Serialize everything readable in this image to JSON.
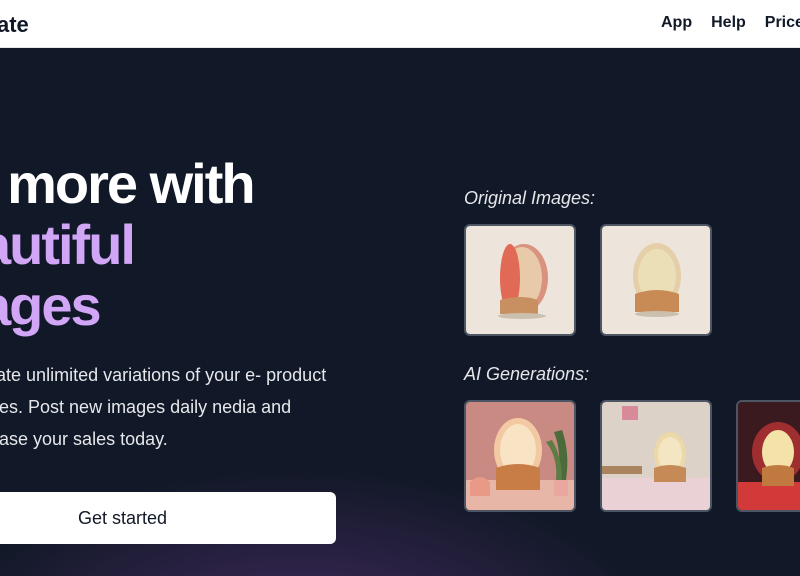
{
  "nav": {
    "brand": "ate",
    "links": [
      "App",
      "Help",
      "Price"
    ]
  },
  "hero": {
    "headline_line1": "l more with",
    "headline_line2": "autiful",
    "headline_line3": "ages",
    "subtext": "enerate unlimited variations of your e- product images. Post new images daily nedia and increase your sales today.",
    "cta_label": "Get started"
  },
  "gallery": {
    "original_label": "Original Images:",
    "ai_label": "AI Generations:"
  },
  "colors": {
    "background": "#111827",
    "accent": "#d1a6f7",
    "nav_bg": "#ffffff"
  }
}
